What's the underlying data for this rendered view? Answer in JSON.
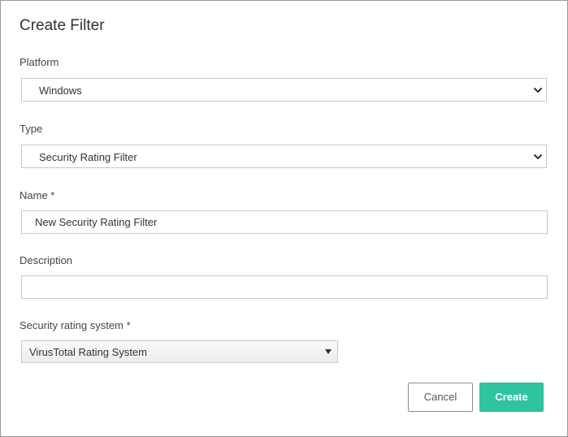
{
  "dialog": {
    "title": "Create Filter"
  },
  "platform": {
    "label": "Platform",
    "value": "Windows"
  },
  "type": {
    "label": "Type",
    "value": "Security Rating Filter"
  },
  "name": {
    "label": "Name *",
    "value": "New Security Rating Filter"
  },
  "description": {
    "label": "Description",
    "value": ""
  },
  "rating_system": {
    "label": "Security rating system *",
    "value": "VirusTotal Rating System"
  },
  "buttons": {
    "cancel": "Cancel",
    "create": "Create"
  },
  "colors": {
    "accent": "#2fc3a0",
    "border": "#c8c8c8"
  }
}
